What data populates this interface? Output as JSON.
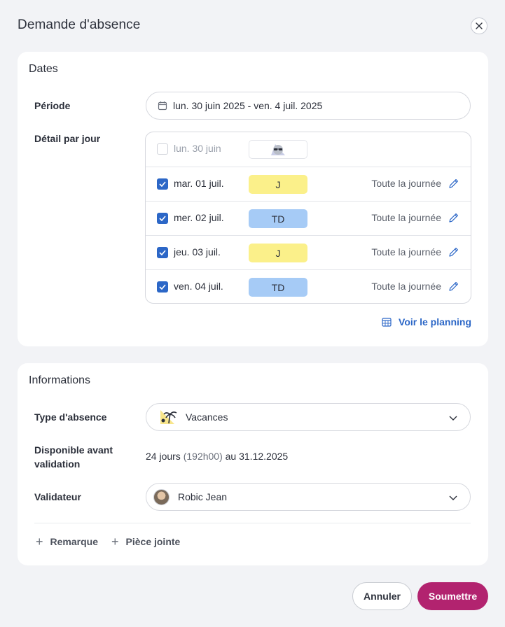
{
  "dialog": {
    "title": "Demande d'absence",
    "close_icon": "close-icon"
  },
  "dates": {
    "title": "Dates",
    "period_label": "Période",
    "period_value": "lun. 30 juin 2025 - ven. 4 juil. 2025",
    "detail_label": "Détail par jour",
    "days": [
      {
        "label": "lun. 30 juin",
        "checked": false,
        "badge": "",
        "badge_icon": "weekend-sunglasses-icon",
        "duration": ""
      },
      {
        "label": "mar. 01 juil.",
        "checked": true,
        "badge": "J",
        "badge_color": "#fbf08a",
        "duration": "Toute la journée"
      },
      {
        "label": "mer. 02 juil.",
        "checked": true,
        "badge": "TD",
        "badge_color": "#a6cbf6",
        "duration": "Toute la journée"
      },
      {
        "label": "jeu. 03 juil.",
        "checked": true,
        "badge": "J",
        "badge_color": "#fbf08a",
        "duration": "Toute la journée"
      },
      {
        "label": "ven. 04 juil.",
        "checked": true,
        "badge": "TD",
        "badge_color": "#a6cbf6",
        "duration": "Toute la journée"
      }
    ],
    "planning_link": "Voir le planning"
  },
  "info": {
    "title": "Informations",
    "type_label": "Type d'absence",
    "type_value": "Vacances",
    "type_icon": "palm-tree-icon",
    "available_label_1": "Disponible avant",
    "available_label_2": "validation",
    "available_days": "24 jours",
    "available_hours": "(192h00)",
    "available_until": "au 31.12.2025",
    "validator_label": "Validateur",
    "validator_name": "Robic Jean",
    "remark_link": "Remarque",
    "attachment_link": "Pièce jointe"
  },
  "actions": {
    "cancel": "Annuler",
    "submit": "Soumettre"
  },
  "colors": {
    "accent": "#2c67c7",
    "submit": "#b2236f"
  }
}
